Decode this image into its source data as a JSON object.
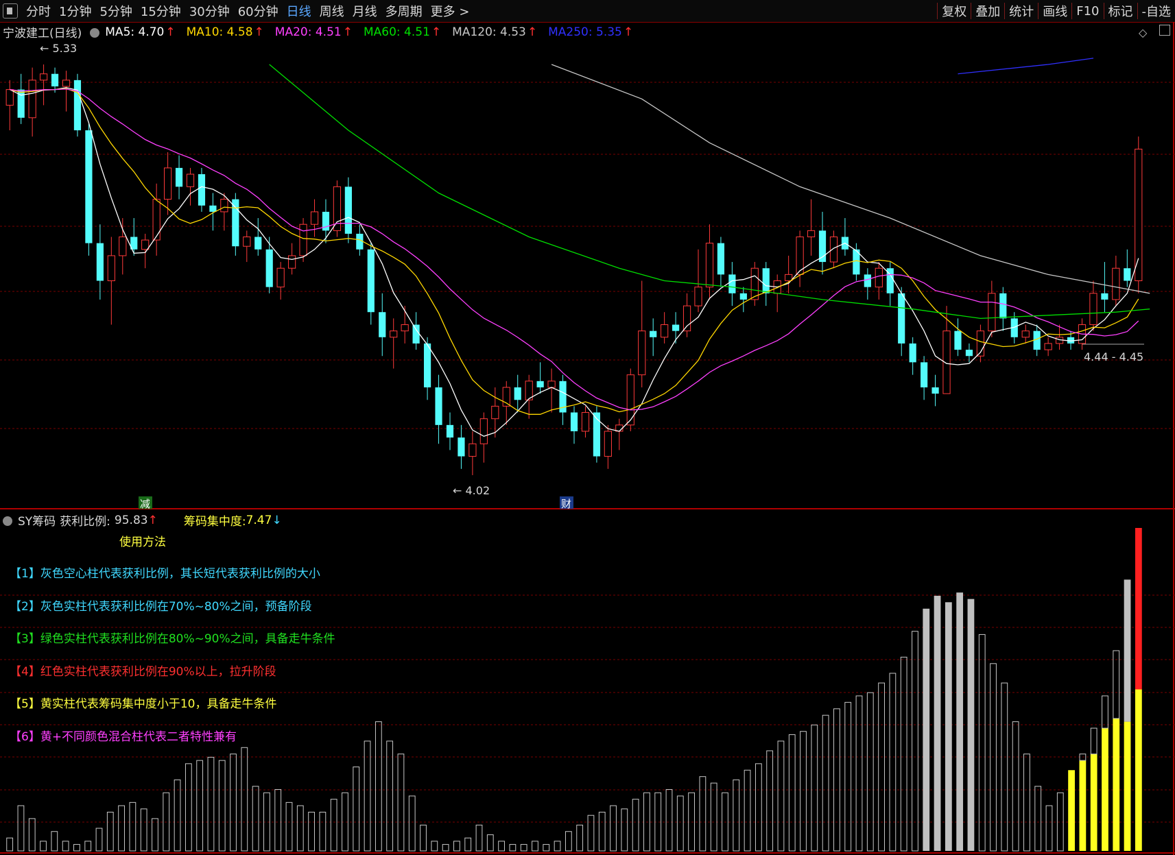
{
  "toolbar": {
    "periods": [
      "分时",
      "1分钟",
      "5分钟",
      "15分钟",
      "30分钟",
      "60分钟",
      "日线",
      "周线",
      "月线",
      "多周期",
      "更多 >"
    ],
    "active": "日线",
    "right": [
      "复权",
      "叠加",
      "统计",
      "画线",
      "F10",
      "标记",
      "-自选"
    ]
  },
  "legend_main": {
    "stock": "宁波建工(日线)",
    "ma": [
      {
        "label": "MA5:",
        "value": "4.70",
        "arrow": "↑",
        "color": "#ffffff"
      },
      {
        "label": "MA10:",
        "value": "4.58",
        "arrow": "↑",
        "color": "#ffd700"
      },
      {
        "label": "MA20:",
        "value": "4.51",
        "arrow": "↑",
        "color": "#ff40ff"
      },
      {
        "label": "MA60:",
        "value": "4.51",
        "arrow": "↑",
        "color": "#00e000"
      },
      {
        "label": "MA120:",
        "value": "4.53",
        "arrow": "↑",
        "color": "#c8c8c8"
      },
      {
        "label": "MA250:",
        "value": "5.35",
        "arrow": "↑",
        "color": "#3030ff"
      }
    ],
    "arrow_color": "#ff3030"
  },
  "legend_sub": {
    "name": "SY筹码",
    "profit_label": "获利比例:",
    "profit_value": "95.83",
    "profit_arrow": "↑",
    "conc_label": "筹码集中度:",
    "conc_value": "7.47",
    "conc_arrow": "↓"
  },
  "annotations": {
    "high_label": "5.33",
    "low_label": "4.02",
    "range_label": "4.44 - 4.45",
    "marker_jian": "减",
    "marker_cai": "财"
  },
  "notes": {
    "title": "使用方法",
    "items": [
      {
        "text": "【1】灰色空心柱代表获利比例，其长短代表获利比例的大小",
        "color": "#40d8ff"
      },
      {
        "text": "【2】灰色实柱代表获利比例在70%~80%之间，预备阶段",
        "color": "#40d8ff"
      },
      {
        "text": "【3】绿色实柱代表获利比例在80%~90%之间，具备走牛条件",
        "color": "#20e020"
      },
      {
        "text": "【4】红色实柱代表获利比例在90%以上，拉升阶段",
        "color": "#ff3030"
      },
      {
        "text": "【5】黄实柱代表筹码集中度小于10，具备走牛条件",
        "color": "#ffff40"
      },
      {
        "text": "【6】黄+不同颜色混合柱代表二者特性兼有",
        "color": "#ff40ff"
      }
    ]
  },
  "chart_data": [
    {
      "type": "candlestick",
      "title": "宁波建工(日线)",
      "ylim": [
        3.95,
        5.4
      ],
      "ohlc": [
        [
          5.2,
          5.28,
          5.12,
          5.25
        ],
        [
          5.25,
          5.3,
          5.14,
          5.16
        ],
        [
          5.16,
          5.32,
          5.1,
          5.28
        ],
        [
          5.28,
          5.33,
          5.2,
          5.3
        ],
        [
          5.3,
          5.32,
          5.24,
          5.26
        ],
        [
          5.26,
          5.31,
          5.18,
          5.28
        ],
        [
          5.28,
          5.3,
          5.1,
          5.12
        ],
        [
          5.12,
          5.14,
          4.72,
          4.76
        ],
        [
          4.76,
          4.82,
          4.58,
          4.64
        ],
        [
          4.64,
          4.78,
          4.5,
          4.72
        ],
        [
          4.72,
          4.84,
          4.66,
          4.78
        ],
        [
          4.78,
          4.84,
          4.72,
          4.74
        ],
        [
          4.74,
          4.79,
          4.68,
          4.77
        ],
        [
          4.77,
          4.95,
          4.72,
          4.9
        ],
        [
          4.9,
          5.05,
          4.85,
          5.0
        ],
        [
          5.0,
          5.04,
          4.9,
          4.94
        ],
        [
          4.94,
          5.0,
          4.88,
          4.98
        ],
        [
          4.98,
          5.0,
          4.86,
          4.88
        ],
        [
          4.88,
          4.92,
          4.8,
          4.86
        ],
        [
          4.86,
          4.92,
          4.8,
          4.9
        ],
        [
          4.9,
          4.92,
          4.72,
          4.75
        ],
        [
          4.75,
          4.8,
          4.7,
          4.78
        ],
        [
          4.78,
          4.84,
          4.72,
          4.74
        ],
        [
          4.74,
          4.78,
          4.6,
          4.62
        ],
        [
          4.62,
          4.7,
          4.58,
          4.68
        ],
        [
          4.68,
          4.76,
          4.66,
          4.72
        ],
        [
          4.72,
          4.84,
          4.7,
          4.82
        ],
        [
          4.82,
          4.9,
          4.78,
          4.86
        ],
        [
          4.86,
          4.9,
          4.76,
          4.8
        ],
        [
          4.8,
          4.96,
          4.78,
          4.94
        ],
        [
          4.94,
          4.97,
          4.76,
          4.79
        ],
        [
          4.79,
          4.82,
          4.72,
          4.74
        ],
        [
          4.74,
          4.76,
          4.5,
          4.54
        ],
        [
          4.54,
          4.6,
          4.4,
          4.46
        ],
        [
          4.46,
          4.52,
          4.36,
          4.48
        ],
        [
          4.48,
          4.56,
          4.44,
          4.5
        ],
        [
          4.5,
          4.54,
          4.42,
          4.44
        ],
        [
          4.44,
          4.46,
          4.26,
          4.3
        ],
        [
          4.3,
          4.34,
          4.12,
          4.18
        ],
        [
          4.18,
          4.22,
          4.1,
          4.14
        ],
        [
          4.14,
          4.18,
          4.04,
          4.08
        ],
        [
          4.08,
          4.16,
          4.02,
          4.12
        ],
        [
          4.12,
          4.22,
          4.06,
          4.2
        ],
        [
          4.2,
          4.3,
          4.14,
          4.24
        ],
        [
          4.24,
          4.32,
          4.18,
          4.3
        ],
        [
          4.3,
          4.34,
          4.22,
          4.26
        ],
        [
          4.26,
          4.34,
          4.2,
          4.32
        ],
        [
          4.32,
          4.38,
          4.28,
          4.3
        ],
        [
          4.3,
          4.36,
          4.22,
          4.32
        ],
        [
          4.32,
          4.34,
          4.18,
          4.22
        ],
        [
          4.22,
          4.24,
          4.12,
          4.16
        ],
        [
          4.16,
          4.24,
          4.14,
          4.22
        ],
        [
          4.22,
          4.24,
          4.06,
          4.08
        ],
        [
          4.08,
          4.18,
          4.04,
          4.16
        ],
        [
          4.16,
          4.2,
          4.1,
          4.18
        ],
        [
          4.18,
          4.36,
          4.16,
          4.34
        ],
        [
          4.34,
          4.64,
          4.3,
          4.48
        ],
        [
          4.48,
          4.52,
          4.4,
          4.46
        ],
        [
          4.46,
          4.54,
          4.44,
          4.5
        ],
        [
          4.5,
          4.54,
          4.44,
          4.48
        ],
        [
          4.48,
          4.6,
          4.46,
          4.56
        ],
        [
          4.56,
          4.74,
          4.54,
          4.62
        ],
        [
          4.62,
          4.82,
          4.58,
          4.76
        ],
        [
          4.76,
          4.78,
          4.62,
          4.66
        ],
        [
          4.66,
          4.7,
          4.56,
          4.6
        ],
        [
          4.6,
          4.62,
          4.54,
          4.58
        ],
        [
          4.58,
          4.7,
          4.56,
          4.68
        ],
        [
          4.68,
          4.7,
          4.56,
          4.6
        ],
        [
          4.6,
          4.66,
          4.54,
          4.64
        ],
        [
          4.64,
          4.72,
          4.6,
          4.66
        ],
        [
          4.66,
          4.8,
          4.62,
          4.78
        ],
        [
          4.78,
          4.9,
          4.72,
          4.8
        ],
        [
          4.8,
          4.86,
          4.66,
          4.7
        ],
        [
          4.7,
          4.8,
          4.68,
          4.78
        ],
        [
          4.78,
          4.84,
          4.72,
          4.74
        ],
        [
          4.74,
          4.76,
          4.64,
          4.66
        ],
        [
          4.66,
          4.68,
          4.58,
          4.62
        ],
        [
          4.62,
          4.7,
          4.58,
          4.68
        ],
        [
          4.68,
          4.7,
          4.56,
          4.6
        ],
        [
          4.6,
          4.62,
          4.4,
          4.44
        ],
        [
          4.44,
          4.46,
          4.34,
          4.38
        ],
        [
          4.38,
          4.4,
          4.26,
          4.3
        ],
        [
          4.3,
          4.34,
          4.24,
          4.28
        ],
        [
          4.28,
          4.56,
          4.28,
          4.48
        ],
        [
          4.48,
          4.52,
          4.4,
          4.42
        ],
        [
          4.42,
          4.44,
          4.38,
          4.4
        ],
        [
          4.4,
          4.5,
          4.38,
          4.48
        ],
        [
          4.48,
          4.64,
          4.46,
          4.6
        ],
        [
          4.6,
          4.62,
          4.48,
          4.52
        ],
        [
          4.52,
          4.54,
          4.44,
          4.46
        ],
        [
          4.46,
          4.5,
          4.44,
          4.48
        ],
        [
          4.48,
          4.5,
          4.4,
          4.42
        ],
        [
          4.42,
          4.46,
          4.4,
          4.44
        ],
        [
          4.44,
          4.5,
          4.42,
          4.46
        ],
        [
          4.46,
          4.48,
          4.42,
          4.44
        ],
        [
          4.44,
          4.52,
          4.42,
          4.5
        ],
        [
          4.5,
          4.64,
          4.48,
          4.6
        ],
        [
          4.6,
          4.7,
          4.54,
          4.58
        ],
        [
          4.58,
          4.72,
          4.56,
          4.68
        ],
        [
          4.68,
          4.74,
          4.62,
          4.64
        ],
        [
          4.64,
          5.1,
          4.6,
          5.06
        ]
      ]
    },
    {
      "type": "bar",
      "title": "SY筹码",
      "ylim": [
        0,
        100
      ],
      "series": [
        {
          "name": "获利比例",
          "values": [
            4,
            14,
            10,
            3,
            6,
            3,
            2,
            3,
            7,
            12,
            14,
            15,
            13,
            10,
            18,
            22,
            27,
            28,
            29,
            28,
            30,
            32,
            20,
            18,
            19,
            15,
            14,
            12,
            12,
            16,
            18,
            26,
            34,
            40,
            34,
            30,
            17,
            8,
            3,
            2,
            3,
            4,
            8,
            5,
            3,
            2,
            2,
            3,
            2,
            3,
            6,
            8,
            11,
            12,
            14,
            13,
            16,
            18,
            18,
            19,
            17,
            18,
            23,
            21,
            18,
            22,
            25,
            27,
            31,
            34,
            36,
            37,
            39,
            42,
            44,
            46,
            48,
            49,
            52,
            55,
            60,
            68,
            75,
            79,
            77,
            80,
            78,
            67,
            58,
            52,
            40,
            30,
            20,
            14,
            18,
            22,
            30,
            38,
            48,
            62,
            84,
            100
          ]
        },
        {
          "name": "筹码集中度",
          "values": [
            0,
            0,
            0,
            0,
            0,
            0,
            0,
            0,
            0,
            0,
            0,
            0,
            0,
            0,
            0,
            0,
            0,
            0,
            0,
            0,
            0,
            0,
            0,
            0,
            0,
            0,
            0,
            0,
            0,
            0,
            0,
            0,
            0,
            0,
            0,
            0,
            0,
            0,
            0,
            0,
            0,
            0,
            0,
            0,
            0,
            0,
            0,
            0,
            0,
            0,
            0,
            0,
            0,
            0,
            0,
            0,
            0,
            0,
            0,
            0,
            0,
            0,
            0,
            0,
            0,
            0,
            0,
            0,
            0,
            0,
            0,
            0,
            0,
            0,
            0,
            0,
            0,
            0,
            0,
            0,
            0,
            0,
            0,
            0,
            0,
            0,
            0,
            0,
            0,
            0,
            0,
            0,
            0,
            0,
            0,
            25,
            28,
            30,
            38,
            41,
            40,
            50
          ]
        }
      ]
    }
  ]
}
